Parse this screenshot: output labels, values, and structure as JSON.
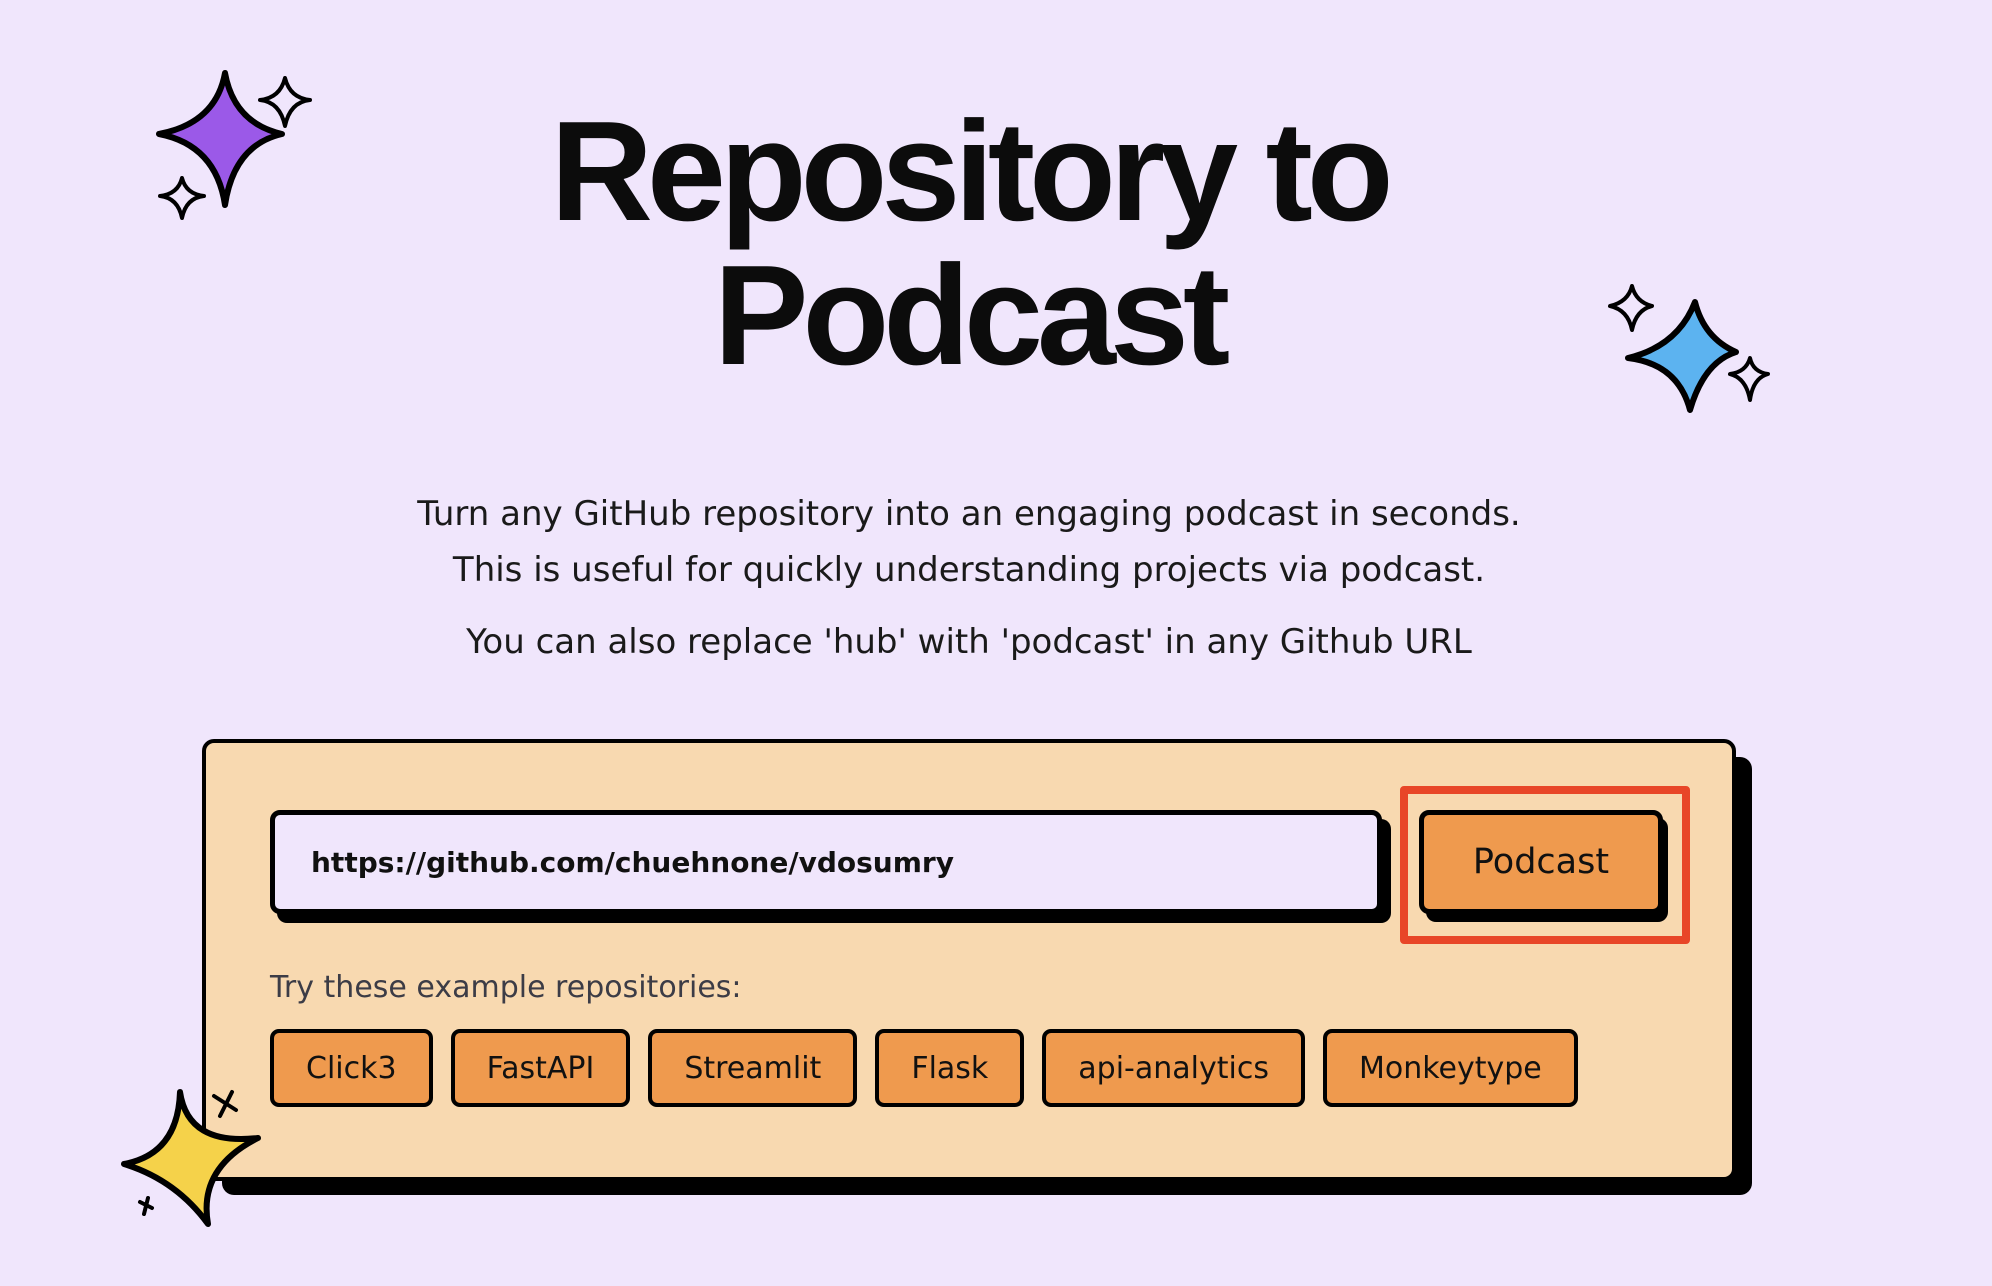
{
  "title_line1": "Repository to",
  "title_line2": "Podcast",
  "description": {
    "line1": "Turn any GitHub repository into an engaging podcast in seconds.",
    "line2": "This is useful for quickly understanding projects via podcast.",
    "line3": "You can also replace 'hub' with 'podcast' in any Github URL"
  },
  "form": {
    "url_value": "https://github.com/chuehnone/vdosumry",
    "submit_label": "Podcast"
  },
  "examples": {
    "label": "Try these example repositories:",
    "items": [
      {
        "label": "Click3"
      },
      {
        "label": "FastAPI"
      },
      {
        "label": "Streamlit"
      },
      {
        "label": "Flask"
      },
      {
        "label": "api-analytics"
      },
      {
        "label": "Monkeytype"
      }
    ]
  },
  "colors": {
    "background": "#f0e6fc",
    "card": "#f8d9b0",
    "button": "#ef9a4e",
    "highlight": "#e84628",
    "sparkle_purple": "#9b59e8",
    "sparkle_blue": "#5cb3f0",
    "sparkle_yellow": "#f5d24a"
  },
  "icons": [
    "sparkle-purple-icon",
    "sparkle-blue-icon",
    "sparkle-yellow-icon"
  ]
}
